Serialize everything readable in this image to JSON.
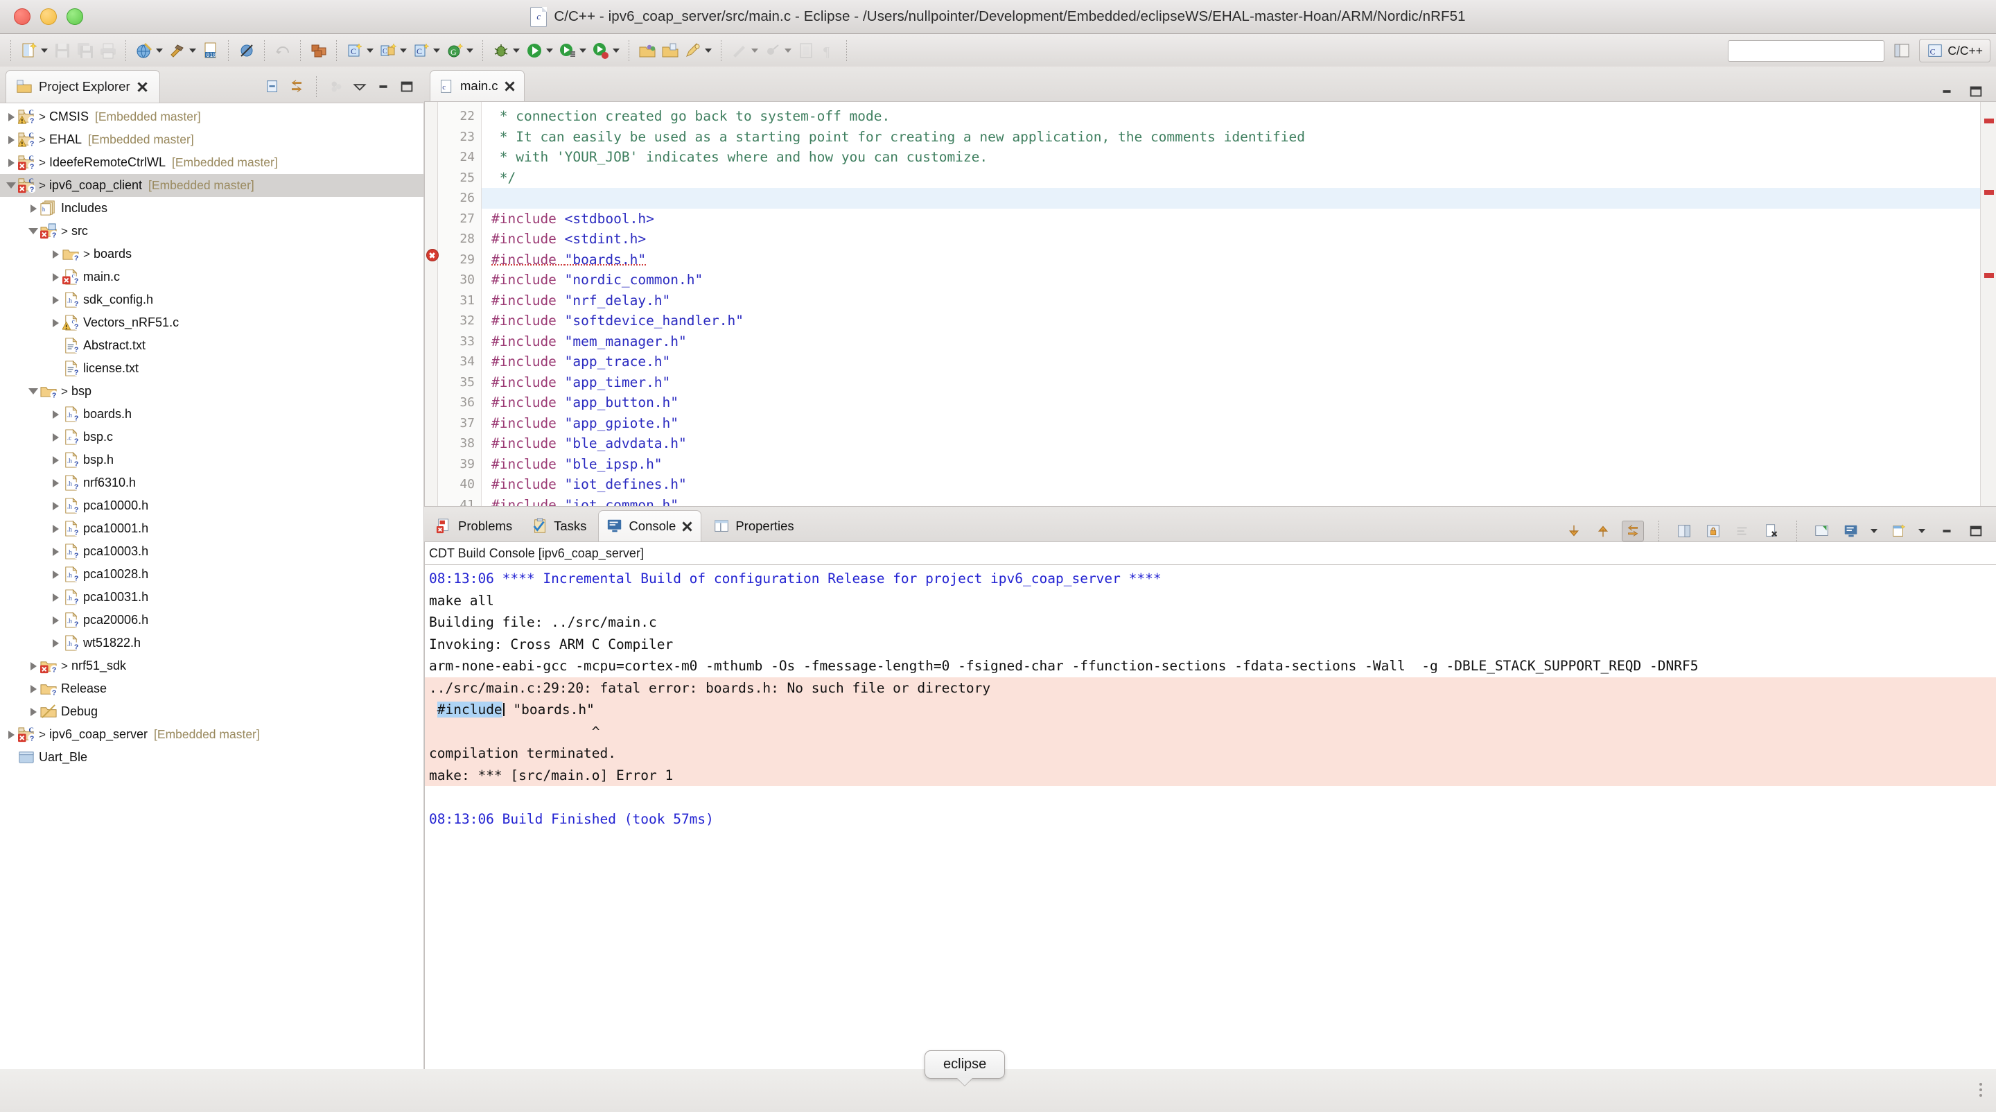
{
  "window": {
    "title": "C/C++ - ipv6_coap_server/src/main.c - Eclipse - /Users/nullpointer/Development/Embedded/eclipseWS/EHAL-master-Hoan/ARM/Nordic/nRF51",
    "icon": "c-file-icon",
    "traffic_lights": [
      "close",
      "minimize",
      "zoom"
    ]
  },
  "toolbar": {
    "search_placeholder": "",
    "search_value": "",
    "perspective_label": "C/C++",
    "buttons": [
      {
        "name": "new-wizard",
        "icon": "new-file-icon",
        "dropdown": true,
        "enabled": true
      },
      {
        "name": "save",
        "icon": "save-icon",
        "dropdown": false,
        "enabled": false
      },
      {
        "name": "save-all",
        "icon": "save-all-icon",
        "dropdown": false,
        "enabled": false
      },
      {
        "name": "print",
        "icon": "print-icon",
        "dropdown": false,
        "enabled": false
      },
      {
        "name": "build-all",
        "icon": "globe-build-icon",
        "dropdown": true,
        "enabled": true
      },
      {
        "name": "build",
        "icon": "hammer-icon",
        "dropdown": true,
        "enabled": true
      },
      {
        "name": "binary",
        "icon": "binary-file-icon",
        "dropdown": false,
        "enabled": true
      },
      {
        "name": "skip-breakpoints",
        "icon": "skip-breakpoints-icon",
        "dropdown": false,
        "enabled": true
      },
      {
        "name": "undo-refactor",
        "icon": "refactor-icon",
        "dropdown": false,
        "enabled": false
      },
      {
        "name": "build-config",
        "icon": "bricks-icon",
        "dropdown": false,
        "enabled": true
      },
      {
        "name": "new-c-project",
        "icon": "new-c-project-icon",
        "dropdown": true,
        "enabled": true
      },
      {
        "name": "new-c-folder",
        "icon": "new-c-folder-icon",
        "dropdown": true,
        "enabled": true
      },
      {
        "name": "new-c-file",
        "icon": "new-c-source-icon",
        "dropdown": true,
        "enabled": true
      },
      {
        "name": "new-class",
        "icon": "new-class-icon",
        "dropdown": true,
        "enabled": true
      },
      {
        "name": "debug",
        "icon": "debug-bug-icon",
        "dropdown": true,
        "enabled": true
      },
      {
        "name": "run",
        "icon": "run-green-icon",
        "dropdown": true,
        "enabled": true
      },
      {
        "name": "external-tools",
        "icon": "external-tools-icon",
        "dropdown": true,
        "enabled": true
      },
      {
        "name": "terminate-run",
        "icon": "run-stop-icon",
        "dropdown": true,
        "enabled": true
      },
      {
        "name": "open-type",
        "icon": "open-type-icon",
        "dropdown": false,
        "enabled": true
      },
      {
        "name": "open-resource",
        "icon": "open-resource-icon",
        "dropdown": false,
        "enabled": true
      },
      {
        "name": "search-refs",
        "icon": "pencil-search-icon",
        "dropdown": true,
        "enabled": true
      },
      {
        "name": "next-annotation",
        "icon": "next-annotation-icon",
        "dropdown": false,
        "enabled": false
      },
      {
        "name": "prev-annotation",
        "icon": "prev-annotation-icon",
        "dropdown": false,
        "enabled": false
      },
      {
        "name": "toggle-block-select",
        "icon": "block-select-icon",
        "dropdown": false,
        "enabled": false
      },
      {
        "name": "show-whitespace",
        "icon": "whitespace-icon",
        "dropdown": false,
        "enabled": false
      }
    ]
  },
  "explorer": {
    "tab_label": "Project Explorer",
    "tab_icon": "project-explorer-icon",
    "tools": [
      "collapse-all-icon",
      "link-with-editor-icon",
      "focus-active-task-icon",
      "view-menu-icon",
      "minimize-icon",
      "maximize-icon"
    ],
    "tree": [
      {
        "indent": 0,
        "arrow": "right",
        "icon": "c-project-warning-icon",
        "gt": true,
        "label": "CMSIS",
        "meta": "[Embedded master]"
      },
      {
        "indent": 0,
        "arrow": "right",
        "icon": "c-project-warning-icon",
        "gt": true,
        "label": "EHAL",
        "meta": "[Embedded master]"
      },
      {
        "indent": 0,
        "arrow": "right",
        "icon": "c-project-error-icon",
        "gt": true,
        "label": "IdeefeRemoteCtrlWL",
        "meta": "[Embedded master]"
      },
      {
        "indent": 0,
        "arrow": "down",
        "icon": "c-project-error-icon",
        "gt": true,
        "label": "ipv6_coap_client",
        "meta": "[Embedded master]",
        "selected": true
      },
      {
        "indent": 1,
        "arrow": "right",
        "icon": "includes-icon",
        "gt": false,
        "label": "Includes",
        "meta": ""
      },
      {
        "indent": 1,
        "arrow": "down",
        "icon": "src-folder-error-icon",
        "gt": true,
        "label": "src",
        "meta": ""
      },
      {
        "indent": 2,
        "arrow": "right",
        "icon": "folder-icon",
        "gt": true,
        "label": "boards",
        "meta": ""
      },
      {
        "indent": 2,
        "arrow": "right",
        "icon": "c-file-error-icon",
        "gt": false,
        "label": "main.c",
        "meta": ""
      },
      {
        "indent": 2,
        "arrow": "right",
        "icon": "h-file-icon",
        "gt": false,
        "label": "sdk_config.h",
        "meta": ""
      },
      {
        "indent": 2,
        "arrow": "right",
        "icon": "c-file-warning-icon",
        "gt": false,
        "label": "Vectors_nRF51.c",
        "meta": ""
      },
      {
        "indent": 2,
        "arrow": "none",
        "icon": "text-file-icon",
        "gt": false,
        "label": "Abstract.txt",
        "meta": ""
      },
      {
        "indent": 2,
        "arrow": "none",
        "icon": "text-file-icon",
        "gt": false,
        "label": "license.txt",
        "meta": ""
      },
      {
        "indent": 1,
        "arrow": "down",
        "icon": "folder-icon",
        "gt": true,
        "label": "bsp",
        "meta": ""
      },
      {
        "indent": 2,
        "arrow": "right",
        "icon": "h-file-icon",
        "gt": false,
        "label": "boards.h",
        "meta": ""
      },
      {
        "indent": 2,
        "arrow": "right",
        "icon": "c-file-icon",
        "gt": false,
        "label": "bsp.c",
        "meta": ""
      },
      {
        "indent": 2,
        "arrow": "right",
        "icon": "h-file-icon",
        "gt": false,
        "label": "bsp.h",
        "meta": ""
      },
      {
        "indent": 2,
        "arrow": "right",
        "icon": "h-file-icon",
        "gt": false,
        "label": "nrf6310.h",
        "meta": ""
      },
      {
        "indent": 2,
        "arrow": "right",
        "icon": "h-file-icon",
        "gt": false,
        "label": "pca10000.h",
        "meta": ""
      },
      {
        "indent": 2,
        "arrow": "right",
        "icon": "h-file-icon",
        "gt": false,
        "label": "pca10001.h",
        "meta": ""
      },
      {
        "indent": 2,
        "arrow": "right",
        "icon": "h-file-icon",
        "gt": false,
        "label": "pca10003.h",
        "meta": ""
      },
      {
        "indent": 2,
        "arrow": "right",
        "icon": "h-file-icon",
        "gt": false,
        "label": "pca10028.h",
        "meta": ""
      },
      {
        "indent": 2,
        "arrow": "right",
        "icon": "h-file-icon",
        "gt": false,
        "label": "pca10031.h",
        "meta": ""
      },
      {
        "indent": 2,
        "arrow": "right",
        "icon": "h-file-icon",
        "gt": false,
        "label": "pca20006.h",
        "meta": ""
      },
      {
        "indent": 2,
        "arrow": "right",
        "icon": "h-file-icon",
        "gt": false,
        "label": "wt51822.h",
        "meta": ""
      },
      {
        "indent": 1,
        "arrow": "right",
        "icon": "folder-error-icon",
        "gt": true,
        "label": "nrf51_sdk",
        "meta": ""
      },
      {
        "indent": 1,
        "arrow": "right",
        "icon": "folder-icon",
        "gt": false,
        "label": "Release",
        "meta": ""
      },
      {
        "indent": 1,
        "arrow": "right",
        "icon": "folder-build-icon",
        "gt": false,
        "label": "Debug",
        "meta": ""
      },
      {
        "indent": 0,
        "arrow": "right",
        "icon": "c-project-error-icon",
        "gt": true,
        "label": "ipv6_coap_server",
        "meta": "[Embedded master]"
      },
      {
        "indent": 0,
        "arrow": "none",
        "icon": "closed-project-icon",
        "gt": false,
        "label": "Uart_Ble",
        "meta": ""
      }
    ]
  },
  "editor": {
    "tab": {
      "label": "main.c",
      "icon": "c-file-icon",
      "close": "close-icon"
    },
    "tools": [
      "minimize-icon",
      "maximize-icon"
    ],
    "first_line_number": 22,
    "highlighted_line": 26,
    "error_line": 29,
    "lines": [
      {
        "n": 22,
        "segments": [
          {
            "t": " * connection created go back to system-off mode.",
            "c": "cmt"
          }
        ]
      },
      {
        "n": 23,
        "segments": [
          {
            "t": " * It can easily be used as a starting point for creating a new application, the comments identified",
            "c": "cmt"
          }
        ]
      },
      {
        "n": 24,
        "segments": [
          {
            "t": " * with 'YOUR_JOB' indicates where and how you can customize.",
            "c": "cmt"
          }
        ]
      },
      {
        "n": 25,
        "segments": [
          {
            "t": " */",
            "c": "cmt"
          }
        ]
      },
      {
        "n": 26,
        "segments": [
          {
            "t": "",
            "c": ""
          }
        ]
      },
      {
        "n": 27,
        "segments": [
          {
            "t": "#include ",
            "c": "pp"
          },
          {
            "t": "<stdbool.h>",
            "c": "str"
          }
        ]
      },
      {
        "n": 28,
        "segments": [
          {
            "t": "#include ",
            "c": "pp"
          },
          {
            "t": "<stdint.h>",
            "c": "str"
          }
        ]
      },
      {
        "n": 29,
        "segments": [
          {
            "t": "#include ",
            "c": "pp err-u"
          },
          {
            "t": "\"boards.h\"",
            "c": "str err-u"
          }
        ]
      },
      {
        "n": 30,
        "segments": [
          {
            "t": "#include ",
            "c": "pp"
          },
          {
            "t": "\"nordic_common.h\"",
            "c": "str"
          }
        ]
      },
      {
        "n": 31,
        "segments": [
          {
            "t": "#include ",
            "c": "pp"
          },
          {
            "t": "\"nrf_delay.h\"",
            "c": "str"
          }
        ]
      },
      {
        "n": 32,
        "segments": [
          {
            "t": "#include ",
            "c": "pp"
          },
          {
            "t": "\"softdevice_handler.h\"",
            "c": "str"
          }
        ]
      },
      {
        "n": 33,
        "segments": [
          {
            "t": "#include ",
            "c": "pp"
          },
          {
            "t": "\"mem_manager.h\"",
            "c": "str"
          }
        ]
      },
      {
        "n": 34,
        "segments": [
          {
            "t": "#include ",
            "c": "pp"
          },
          {
            "t": "\"app_trace.h\"",
            "c": "str"
          }
        ]
      },
      {
        "n": 35,
        "segments": [
          {
            "t": "#include ",
            "c": "pp"
          },
          {
            "t": "\"app_timer.h\"",
            "c": "str"
          }
        ]
      },
      {
        "n": 36,
        "segments": [
          {
            "t": "#include ",
            "c": "pp"
          },
          {
            "t": "\"app_button.h\"",
            "c": "str"
          }
        ]
      },
      {
        "n": 37,
        "segments": [
          {
            "t": "#include ",
            "c": "pp"
          },
          {
            "t": "\"app_gpiote.h\"",
            "c": "str"
          }
        ]
      },
      {
        "n": 38,
        "segments": [
          {
            "t": "#include ",
            "c": "pp"
          },
          {
            "t": "\"ble_advdata.h\"",
            "c": "str"
          }
        ]
      },
      {
        "n": 39,
        "segments": [
          {
            "t": "#include ",
            "c": "pp"
          },
          {
            "t": "\"ble_ipsp.h\"",
            "c": "str"
          }
        ]
      },
      {
        "n": 40,
        "segments": [
          {
            "t": "#include ",
            "c": "pp"
          },
          {
            "t": "\"iot_defines.h\"",
            "c": "str"
          }
        ]
      },
      {
        "n": 41,
        "segments": [
          {
            "t": "#include ",
            "c": "pp"
          },
          {
            "t": "\"iot_common.h\"",
            "c": "str"
          }
        ]
      }
    ]
  },
  "bottom_panel": {
    "tabs": [
      {
        "label": "Problems",
        "icon": "problems-icon",
        "active": false,
        "closable": false
      },
      {
        "label": "Tasks",
        "icon": "tasks-icon",
        "active": false,
        "closable": false
      },
      {
        "label": "Console",
        "icon": "console-icon",
        "active": true,
        "closable": true
      },
      {
        "label": "Properties",
        "icon": "properties-icon",
        "active": false,
        "closable": false
      }
    ],
    "tools": [
      "scroll-down-icon",
      "scroll-up-icon",
      "scroll-lock-icon",
      "pin-console-icon",
      "lock-console-icon",
      "clear-console-icon",
      "remove-console-icon",
      "new-console-view-icon",
      "display-console-icon",
      "open-console-icon",
      "minimize-icon",
      "maximize-icon"
    ],
    "console_header": "CDT Build Console [ipv6_coap_server]",
    "console_lines": [
      {
        "text": "08:13:06 **** Incremental Build of configuration Release for project ipv6_coap_server ****",
        "style": "blue"
      },
      {
        "text": "make all",
        "style": ""
      },
      {
        "text": "Building file: ../src/main.c",
        "style": ""
      },
      {
        "text": "Invoking: Cross ARM C Compiler",
        "style": ""
      },
      {
        "text": "arm-none-eabi-gcc -mcpu=cortex-m0 -mthumb -Os -fmessage-length=0 -fsigned-char -ffunction-sections -fdata-sections -Wall  -g -DBLE_STACK_SUPPORT_REQD -DNRF5",
        "style": ""
      },
      {
        "text": "../src/main.c:29:20: fatal error: boards.h: No such file or directory",
        "style": "errbg"
      },
      {
        "text": " #include \"boards.h\"",
        "style": "errbg-token"
      },
      {
        "text": "                    ^",
        "style": "errbg"
      },
      {
        "text": "compilation terminated.",
        "style": "errbg"
      },
      {
        "text": "make: *** [src/main.o] Error 1",
        "style": "errbg"
      },
      {
        "text": "",
        "style": ""
      },
      {
        "text": "08:13:06 Build Finished (took 57ms)",
        "style": "blue"
      }
    ],
    "selected_token": "#include"
  },
  "dock": {
    "tooltip": "eclipse"
  },
  "colors": {
    "accent_blue": "#2323d2",
    "error_red": "#d63b2f",
    "error_bg": "#fbe2da",
    "comment_green": "#3f7f5f",
    "preproc_purple": "#9b3a74",
    "string_blue": "#2a2ac0",
    "meta_gold": "#9a8a5f",
    "selection_gray": "#d4d2d0"
  }
}
